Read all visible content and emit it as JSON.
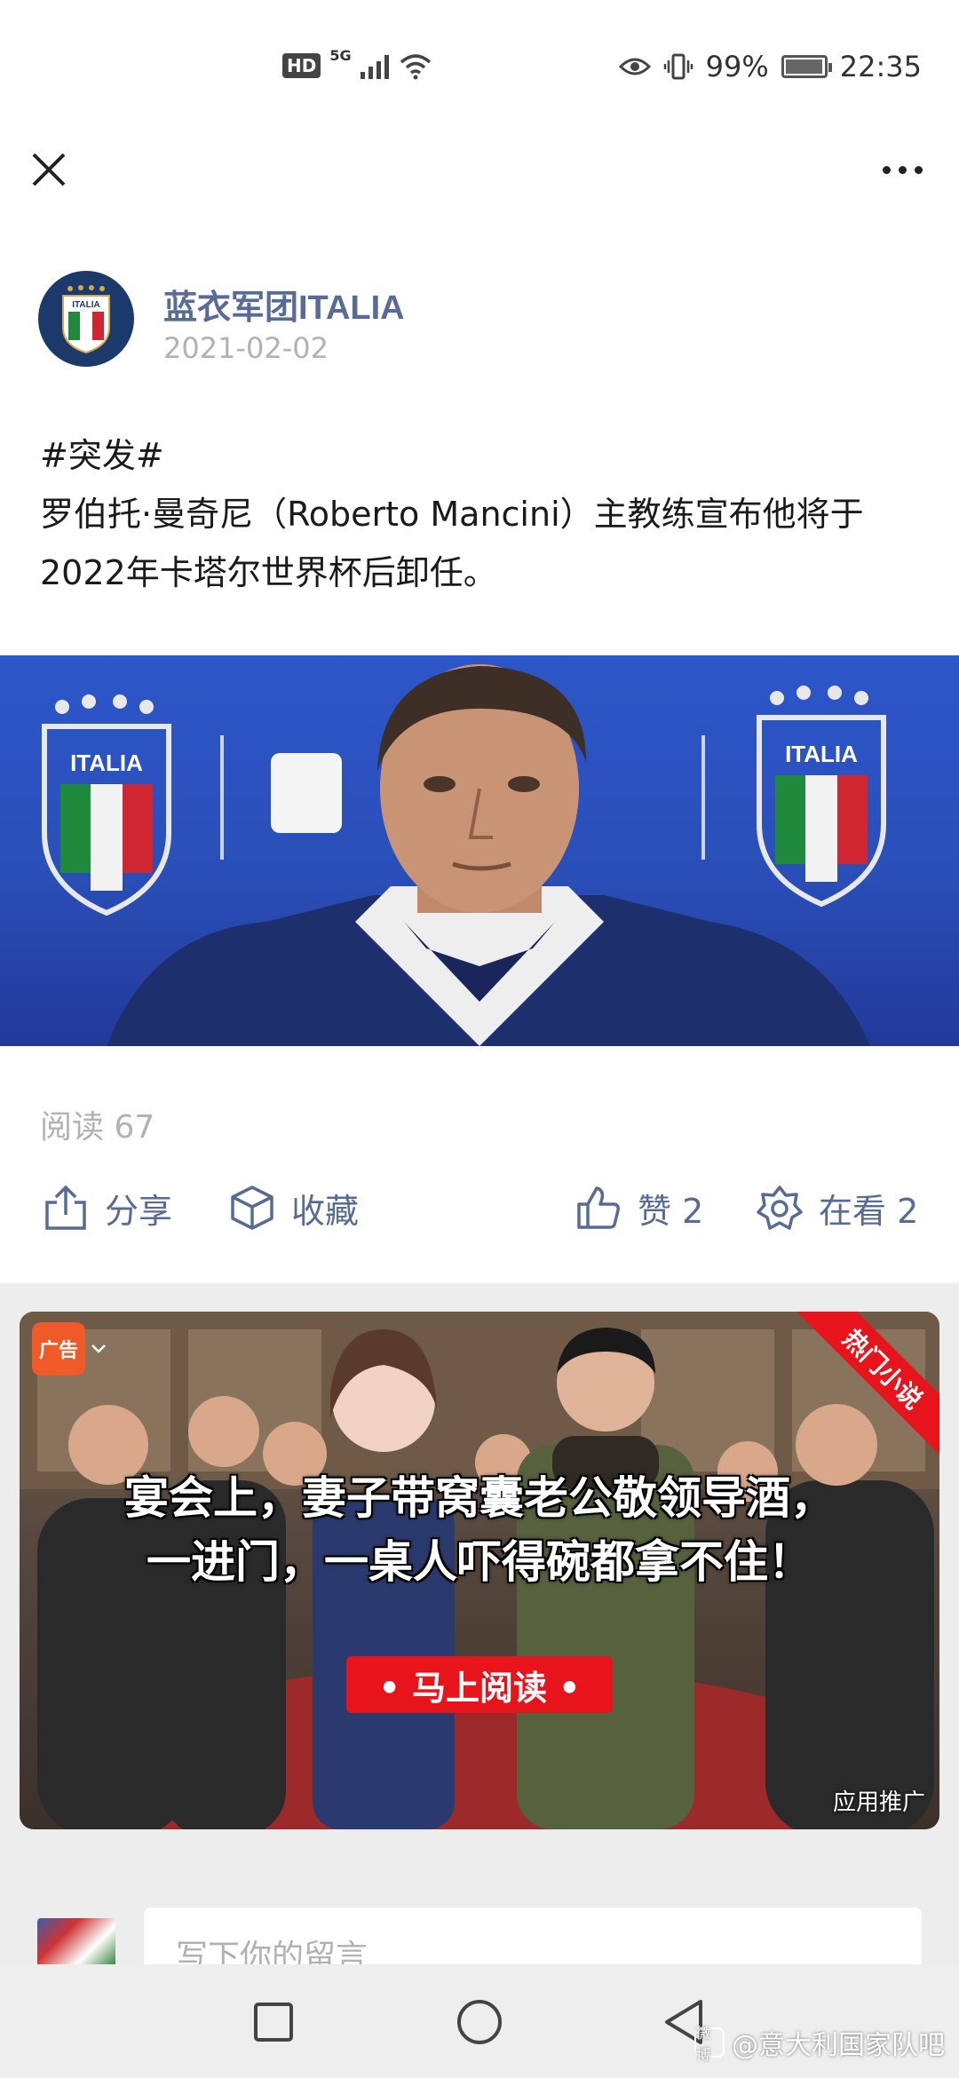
{
  "status_bar": {
    "hd": "HD",
    "network": "5G",
    "battery_percent": "99%",
    "battery_level": 0.99,
    "time": "22:35",
    "icons": [
      "eye-icon",
      "vibrate-icon",
      "wifi-icon",
      "signal-icon",
      "battery-icon"
    ]
  },
  "header": {
    "close_icon": "close-icon",
    "more_icon": "more-icon"
  },
  "author": {
    "name": "蓝衣军团ITALIA",
    "date": "2021-02-02",
    "avatar_text": "ITALIA"
  },
  "post": {
    "line1": "#突发#",
    "line2": "罗伯托·曼奇尼（Roberto Mancini）主教练宣布他将于2022年卡塔尔世界杯后卸任。"
  },
  "photo": {
    "crest_text": "ITALIA"
  },
  "stats": {
    "read_label": "阅读 67"
  },
  "actions": {
    "share": "分享",
    "favorite": "收藏",
    "like": "赞 2",
    "watching": "在看 2"
  },
  "ad": {
    "badge": "广告",
    "ribbon": "热门小说",
    "caption_line1": "宴会上，妻子带窝囊老公敬领导酒，",
    "caption_line2": "一进门，一桌人吓得碗都拿不住！",
    "cta": "• 马上阅读 •",
    "label": "应用推广"
  },
  "comment": {
    "placeholder": "写下你的留言"
  },
  "nav": {
    "watermark": "@意大利国家队吧",
    "watermark_logo": "微博"
  },
  "colors": {
    "link_blue": "#576b95",
    "muted_gray": "#b2b2b2",
    "ad_red": "#e8141c",
    "photo_blue": "#2c56c9"
  }
}
